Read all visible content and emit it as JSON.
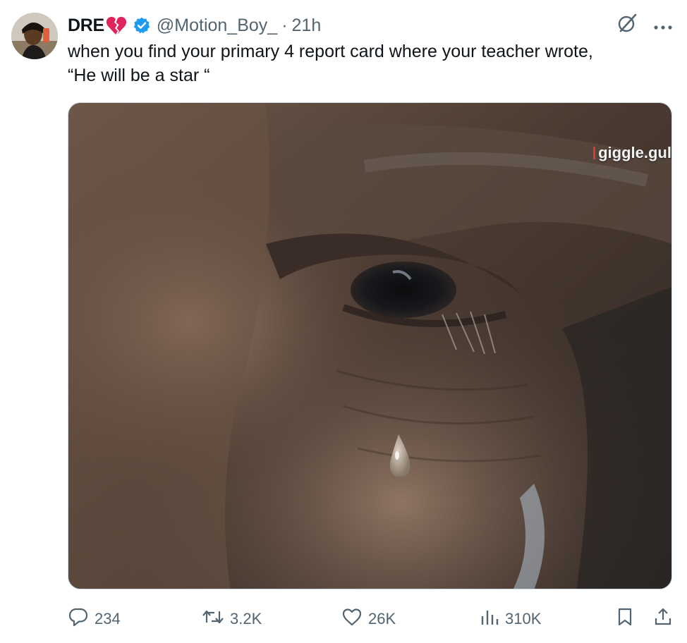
{
  "tweet": {
    "display_name": "DRE",
    "handle": "@Motion_Boy_",
    "separator": "·",
    "time": "21h",
    "text_line1": "when you find your primary 4 report card where your teacher wrote,",
    "text_line2": "“He will be a star “"
  },
  "media": {
    "watermark": "giggle.gul"
  },
  "actions": {
    "replies": "234",
    "reposts": "3.2K",
    "likes": "26K",
    "views": "310K"
  },
  "icons": {
    "heart": "broken-heart-icon",
    "verified": "verified-badge-icon",
    "grok": "grok-icon",
    "more": "more-icon",
    "reply": "reply-icon",
    "repost": "repost-icon",
    "like": "like-icon",
    "views": "views-icon",
    "bookmark": "bookmark-icon",
    "share": "share-icon"
  },
  "colors": {
    "text": "#0f1419",
    "secondary": "#536471",
    "verified": "#1d9bf0",
    "heart": "#e0245e"
  }
}
